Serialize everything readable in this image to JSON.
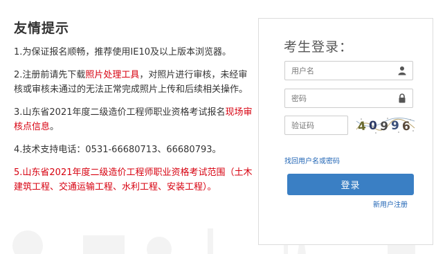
{
  "tips": {
    "title": "友情提示",
    "item1": "1.为保证报名顺畅，推荐使用IE10及以上版本浏览器。",
    "item2_pre": "2.注册前请先下载",
    "item2_link": "照片处理工具",
    "item2_post": "，对照片进行审核，未经审核或审核未通过的无法正常完成照片上传和后续相关操作。",
    "item3_pre": "3.山东省2021年度二级造价工程师职业资格考试报名",
    "item3_link": "现场审核点信息",
    "item3_post": "。",
    "item4": "4.技术支持电话：0531-66680713、66680793。",
    "item5": "5.山东省2021年度二级造价工程师职业资格考试范围（土木建筑工程、交通运输工程、水利工程、安装工程）。"
  },
  "login": {
    "title": "考生登录：",
    "username_placeholder": "用户名",
    "password_placeholder": "密码",
    "captcha_placeholder": "验证码",
    "captcha_text": "40996",
    "forgot_link": "找回用户名或密码",
    "login_button": "登录",
    "register_link": "新用户注册"
  },
  "colors": {
    "accent": "#3a7fc4",
    "link": "#2165b5",
    "warning_red": "#d7000f"
  },
  "icons": {
    "username": "user-icon",
    "password": "lock-icon"
  }
}
